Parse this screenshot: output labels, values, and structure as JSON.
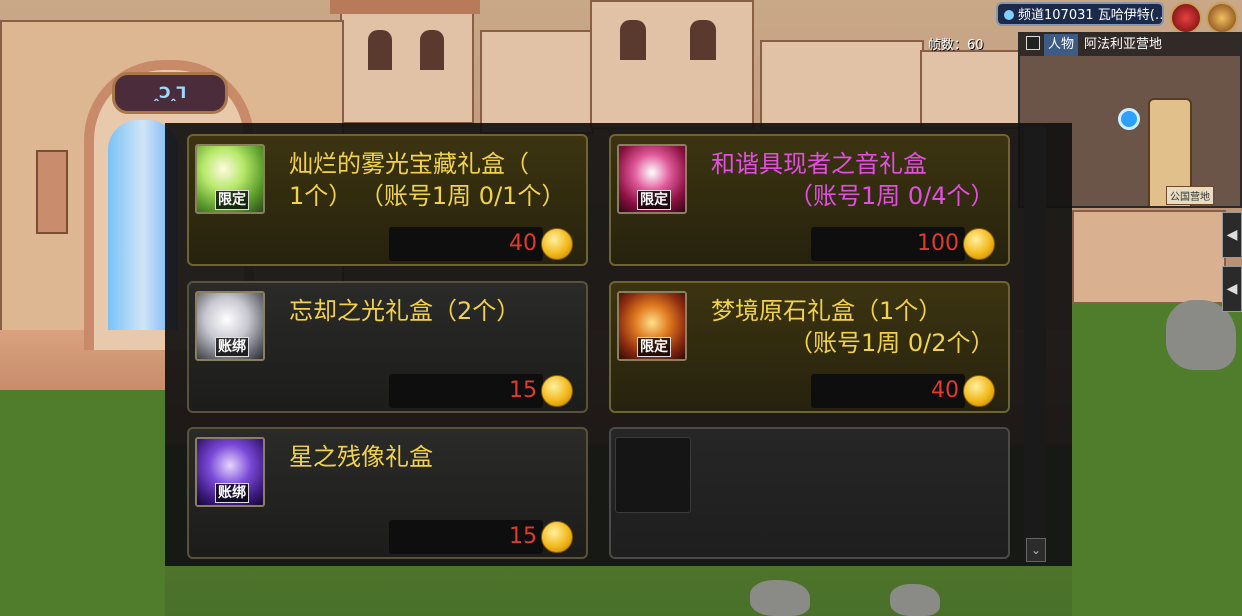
{
  "hud": {
    "channel": "频道107031 瓦哈伊特(…",
    "fps": "帧数：60"
  },
  "minimap": {
    "tab": "人物",
    "area": "阿法利亚营地",
    "place_label": "公国营地"
  },
  "background": {
    "gate_sign": "ꞈƆꞈꞀ"
  },
  "shop": {
    "items": [
      {
        "name_line1": "灿烂的雾光宝藏礼盒（",
        "name_line2": "1个） （账号1周 0/1个）",
        "tag": "限定",
        "price": "40",
        "color": "#f2d24a"
      },
      {
        "name_line1": "和谐具现者之音礼盒",
        "name_line2": "（账号1周 0/4个）",
        "tag": "限定",
        "price": "100",
        "color": "#e24fe0"
      },
      {
        "name_line1": "忘却之光礼盒（2个）",
        "name_line2": "",
        "tag": "账绑",
        "price": "15",
        "color": "#f2d24a"
      },
      {
        "name_line1": "梦境原石礼盒（1个）",
        "name_line2": "（账号1周 0/2个）",
        "tag": "限定",
        "price": "40",
        "color": "#f2d24a"
      },
      {
        "name_line1": "星之残像礼盒",
        "name_line2": "",
        "tag": "账绑",
        "price": "15",
        "color": "#f2d24a"
      }
    ]
  }
}
